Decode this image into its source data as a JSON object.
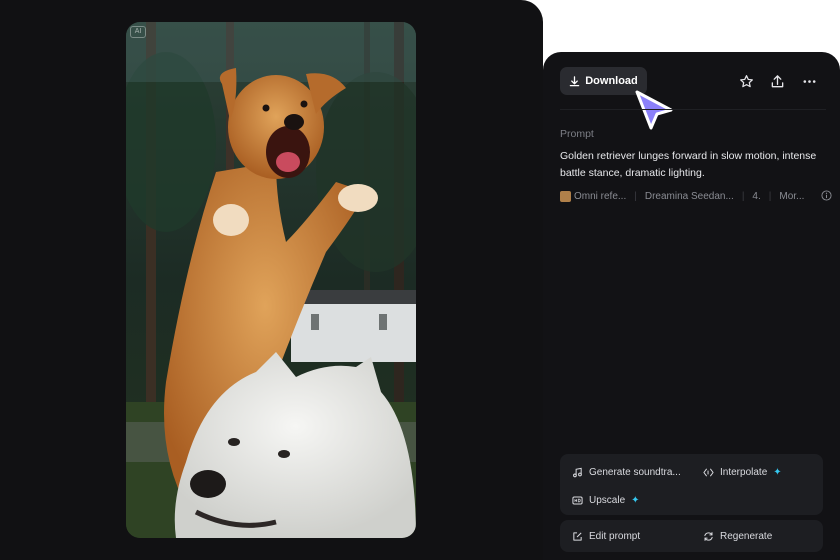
{
  "media": {
    "badge": "AI",
    "description_icon": "dog-video-thumbnail"
  },
  "toolbar": {
    "download_label": "Download",
    "favorite_icon": "star-icon",
    "share_icon": "upload-icon",
    "more_icon": "more-icon"
  },
  "prompt": {
    "label": "Prompt",
    "text": "Golden retriever lunges forward in slow motion, intense battle stance, dramatic lighting."
  },
  "meta": {
    "reference": "Omni refe...",
    "model": "Dreamina Seedan...",
    "version": "4.",
    "more": "Mor..."
  },
  "tools": {
    "generate_soundtrack": "Generate soundtra...",
    "interpolate": "Interpolate",
    "upscale": "Upscale",
    "sparkle": "✦"
  },
  "actions": {
    "edit_prompt": "Edit prompt",
    "regenerate": "Regenerate"
  },
  "colors": {
    "accent_cursor": "#8b80f9",
    "sparkle": "#35c8f0",
    "panel": "#121215"
  }
}
